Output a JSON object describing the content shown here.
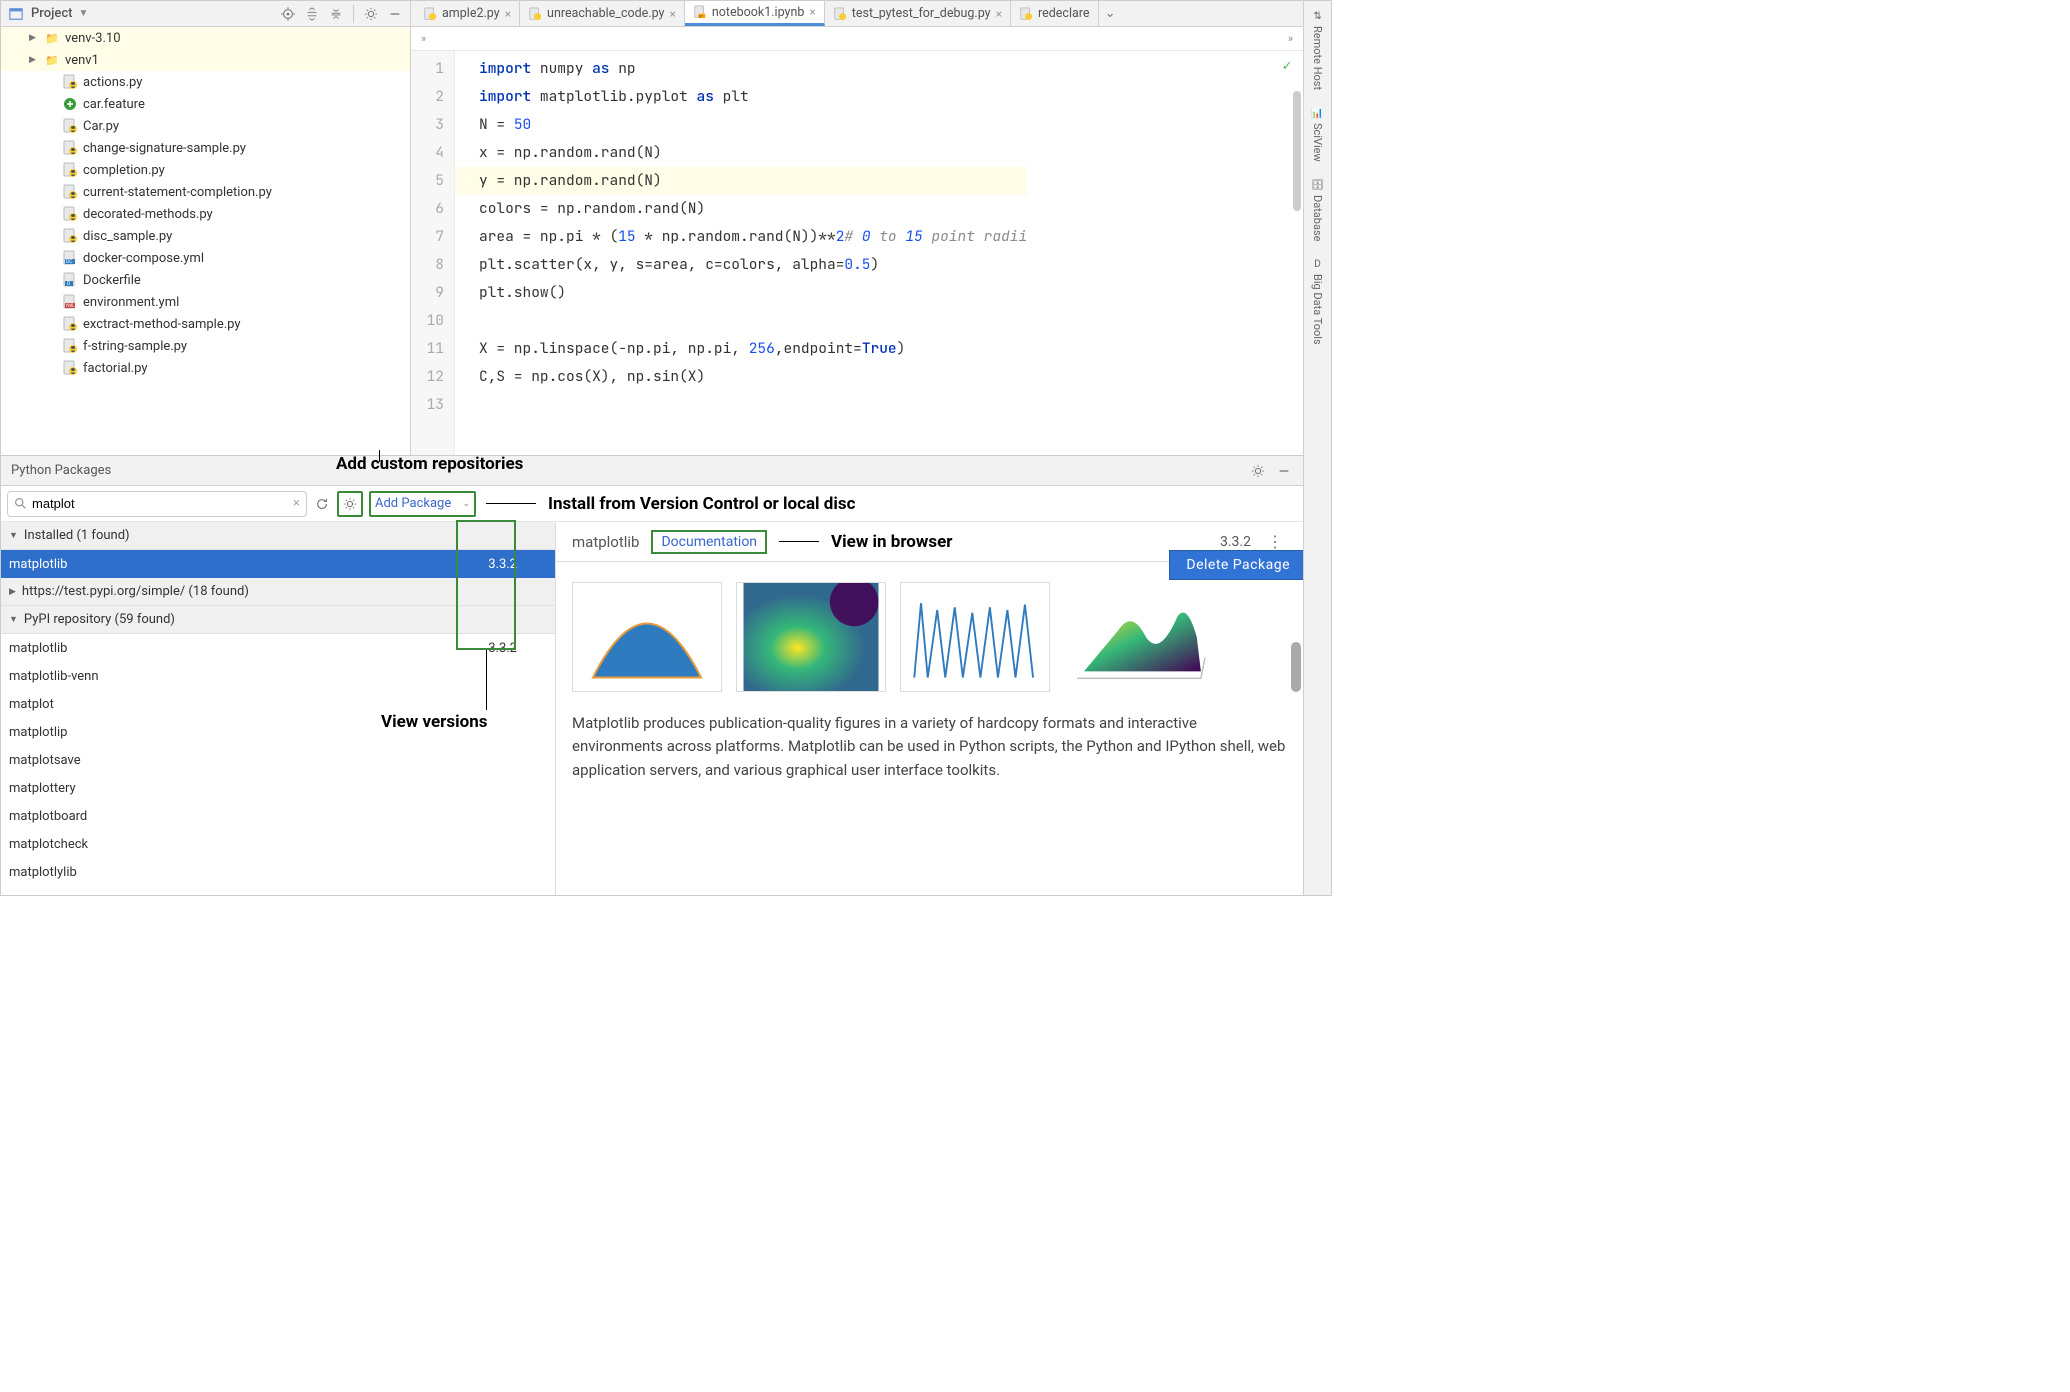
{
  "project": {
    "title": "Project",
    "folders": [
      "venv-3.10",
      "venv1"
    ],
    "files": [
      {
        "name": "actions.py",
        "type": "py"
      },
      {
        "name": "car.feature",
        "type": "feat"
      },
      {
        "name": "Car.py",
        "type": "py"
      },
      {
        "name": "change-signature-sample.py",
        "type": "py"
      },
      {
        "name": "completion.py",
        "type": "py"
      },
      {
        "name": "current-statement-completion.py",
        "type": "py"
      },
      {
        "name": "decorated-methods.py",
        "type": "py"
      },
      {
        "name": "disc_sample.py",
        "type": "py"
      },
      {
        "name": "docker-compose.yml",
        "type": "yml"
      },
      {
        "name": "Dockerfile",
        "type": "docker"
      },
      {
        "name": "environment.yml",
        "type": "yml2"
      },
      {
        "name": "exctract-method-sample.py",
        "type": "py"
      },
      {
        "name": "f-string-sample.py",
        "type": "py"
      },
      {
        "name": "factorial.py",
        "type": "py"
      }
    ]
  },
  "tabs": [
    {
      "label": "ample2.py",
      "active": false,
      "trunc": true
    },
    {
      "label": "unreachable_code.py",
      "active": false
    },
    {
      "label": "notebook1.ipynb",
      "active": true
    },
    {
      "label": "test_pytest_for_debug.py",
      "active": false
    },
    {
      "label": "redeclare",
      "active": false,
      "noclose": true
    }
  ],
  "breadcrumb_chevrons": "»",
  "editor": {
    "lines": [
      "import numpy as np",
      "import matplotlib.pyplot as plt",
      "N = 50",
      "x = np.random.rand(N)",
      "y = np.random.rand(N)",
      "colors = np.random.rand(N)",
      "area = np.pi * (15 * np.random.rand(N))**2  # 0 to 15 point radii",
      "plt.scatter(x, y, s=area, c=colors, alpha=0.5)",
      "plt.show()",
      "",
      "X = np.linspace(-np.pi, np.pi, 256,endpoint=True)",
      "C,S = np.cos(X), np.sin(X)",
      ""
    ],
    "highlighted_line": 5
  },
  "packages": {
    "title": "Python Packages",
    "annot_repos": "Add custom repositories",
    "annot_install": "Install from Version Control or local disc",
    "annot_view": "View in browser",
    "annot_versions": "View versions",
    "search_value": "matplot",
    "add_label": "Add Package",
    "sections": [
      {
        "label": "Installed (1 found)",
        "expanded": true,
        "chev": "▼"
      },
      {
        "label": "https://test.pypi.org/simple/ (18 found)",
        "expanded": false,
        "chev": "▶"
      },
      {
        "label": "PyPI repository (59 found)",
        "expanded": true,
        "chev": "▼"
      }
    ],
    "installed": [
      {
        "name": "matplotlib",
        "version": "3.3.2",
        "selected": true
      }
    ],
    "pypi": [
      {
        "name": "matplotlib",
        "version": "3.3.2"
      },
      {
        "name": "matplotlib-venn"
      },
      {
        "name": "matplot"
      },
      {
        "name": "matplotlip"
      },
      {
        "name": "matplotsave"
      },
      {
        "name": "matplottery"
      },
      {
        "name": "matplotboard"
      },
      {
        "name": "matplotcheck"
      },
      {
        "name": "matplotlylib"
      }
    ],
    "detail": {
      "title": "matplotlib",
      "doc_label": "Documentation",
      "version": "3.3.2",
      "delete_label": "Delete Package",
      "description": "Matplotlib produces publication-quality figures in a variety of hardcopy formats and interactive environments across platforms. Matplotlib can be used in Python scripts, the Python and IPython shell, web application servers, and various graphical user interface toolkits."
    }
  },
  "dock": [
    "Remote Host",
    "SciView",
    "Database",
    "Big Data Tools"
  ]
}
